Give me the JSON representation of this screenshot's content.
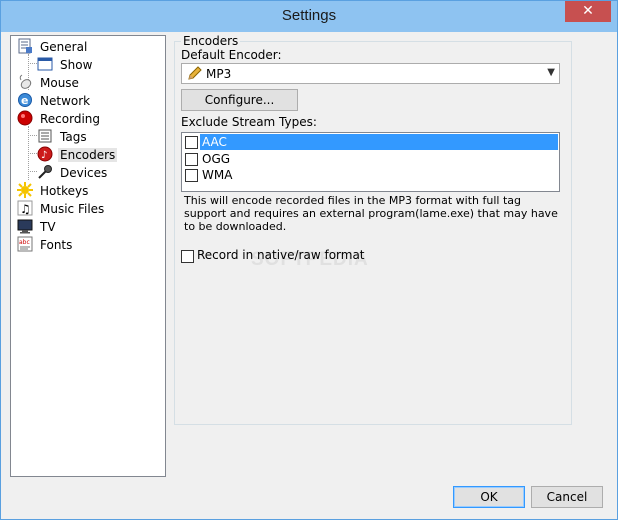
{
  "window": {
    "title": "Settings",
    "close_glyph": "✕"
  },
  "tree": {
    "items": [
      {
        "label": "General",
        "icon": "general-icon"
      },
      {
        "label": "Show",
        "icon": "window-icon"
      },
      {
        "label": "Mouse",
        "icon": "mouse-icon"
      },
      {
        "label": "Network",
        "icon": "network-icon"
      },
      {
        "label": "Recording",
        "icon": "record-icon"
      },
      {
        "label": "Tags",
        "icon": "tags-icon"
      },
      {
        "label": "Encoders",
        "icon": "encoder-icon",
        "selected": true
      },
      {
        "label": "Devices",
        "icon": "microphone-icon"
      },
      {
        "label": "Hotkeys",
        "icon": "hotkeys-icon"
      },
      {
        "label": "Music Files",
        "icon": "music-note-icon"
      },
      {
        "label": "TV",
        "icon": "tv-icon"
      },
      {
        "label": "Fonts",
        "icon": "fonts-icon"
      }
    ]
  },
  "encoders": {
    "group_label": "Encoders",
    "default_label": "Default Encoder:",
    "default_value": "MP3",
    "configure_label": "Configure...",
    "exclude_label": "Exclude Stream Types:",
    "stream_types": [
      {
        "label": "AAC",
        "checked": false,
        "highlighted": true
      },
      {
        "label": "OGG",
        "checked": false
      },
      {
        "label": "WMA",
        "checked": false
      }
    ],
    "description": "This will encode recorded files in the MP3 format with full tag support and requires an external program(lame.exe) that may have to be downloaded.",
    "native_label": "Record in native/raw format",
    "native_checked": false
  },
  "watermark": "SOFTPEDIA",
  "buttons": {
    "ok": "OK",
    "cancel": "Cancel"
  },
  "colors": {
    "titlebar": "#8ec3f1",
    "close": "#c75050",
    "highlight": "#3399ff"
  }
}
